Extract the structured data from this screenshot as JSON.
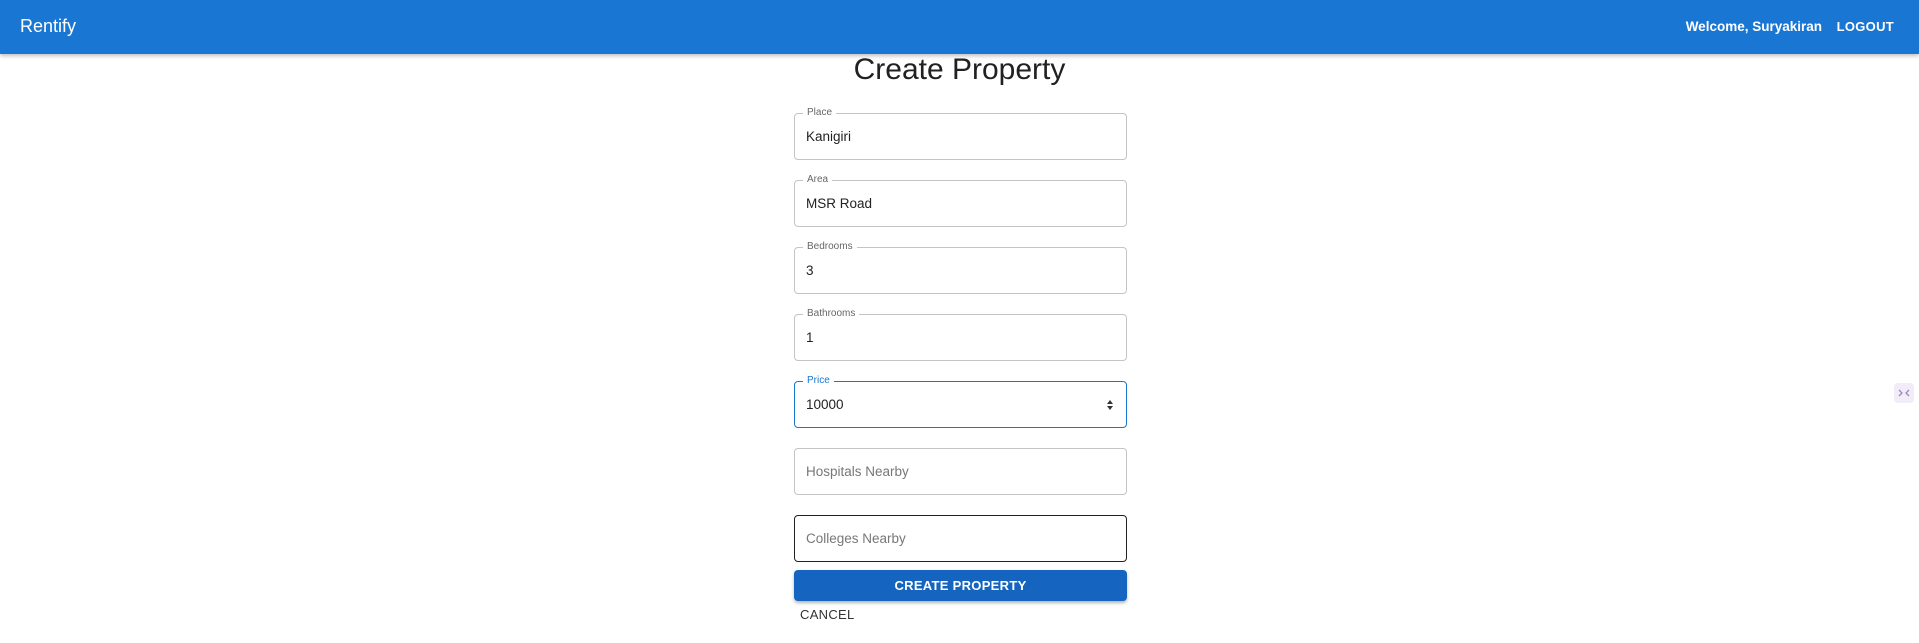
{
  "header": {
    "brand": "Rentify",
    "welcome": "Welcome, Suryakiran",
    "logout_label": "LOGOUT"
  },
  "form": {
    "title": "Create Property",
    "place": {
      "label": "Place",
      "value": "Kanigiri"
    },
    "area": {
      "label": "Area",
      "value": "MSR Road"
    },
    "bedrooms": {
      "label": "Bedrooms",
      "value": "3"
    },
    "bathrooms": {
      "label": "Bathrooms",
      "value": "1"
    },
    "price": {
      "label": "Price",
      "value": "10000"
    },
    "hospitals": {
      "placeholder": "Hospitals Nearby"
    },
    "colleges": {
      "placeholder": "Colleges Nearby"
    },
    "submit_label": "CREATE PROPERTY",
    "cancel_label": "CANCEL"
  },
  "colors": {
    "appbar": "#1976d2",
    "primary_button": "#1565c0",
    "focus_border": "#1976d2"
  },
  "icons": {
    "price_spinner": "up-down-spinner-icon",
    "side_widget": "extension-widget-icon"
  }
}
